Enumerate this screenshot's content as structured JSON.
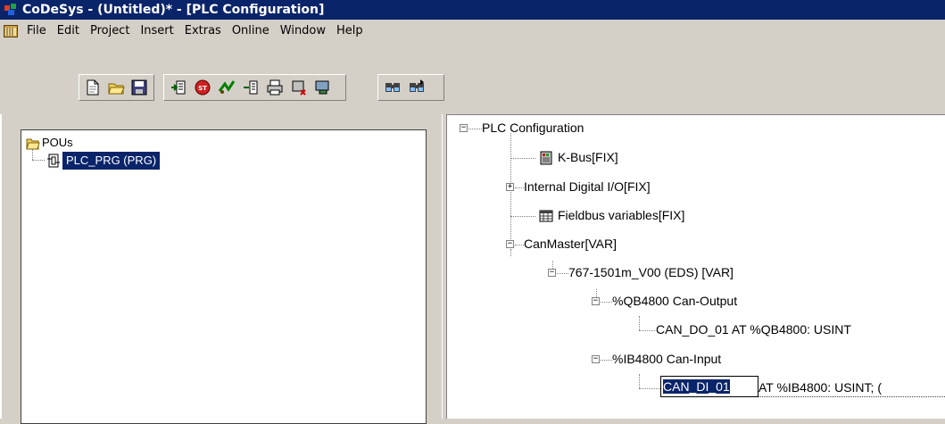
{
  "window": {
    "title": "CoDeSys - (Untitled)* - [PLC Configuration]"
  },
  "menu": {
    "items": [
      "File",
      "Edit",
      "Project",
      "Insert",
      "Extras",
      "Online",
      "Window",
      "Help"
    ]
  },
  "toolbar": {
    "group1": [
      "new-icon",
      "open-icon",
      "save-icon"
    ],
    "group2": [
      "login-icon",
      "stop-icon",
      "run-icon",
      "step-icon",
      "print-icon",
      "logout-icon",
      "monitor-icon"
    ],
    "group3": [
      "find-icon",
      "find-next-icon"
    ]
  },
  "pou_tree": {
    "root": "POUs",
    "children": [
      {
        "label": "PLC_PRG (PRG)",
        "selected": true
      }
    ]
  },
  "config_tree": {
    "root": "PLC Configuration",
    "kbus": "K-Bus[FIX]",
    "internal_io": "Internal Digital I/O[FIX]",
    "fieldbus": "Fieldbus variables[FIX]",
    "canmaster": "CanMaster[VAR]",
    "device": "767-1501m_V00 (EDS)  [VAR]",
    "output_group": "%QB4800 Can-Output",
    "output_var": "CAN_DO_01 AT %QB4800: USINT",
    "input_group": "%IB4800 Can-Input",
    "input_edit_value": "CAN_DI_01",
    "input_var_rest": "AT %IB4800: USINT; ("
  },
  "colors": {
    "title_bar": "#0a246a",
    "selection": "#0a246a",
    "face": "#d4d0c8"
  }
}
